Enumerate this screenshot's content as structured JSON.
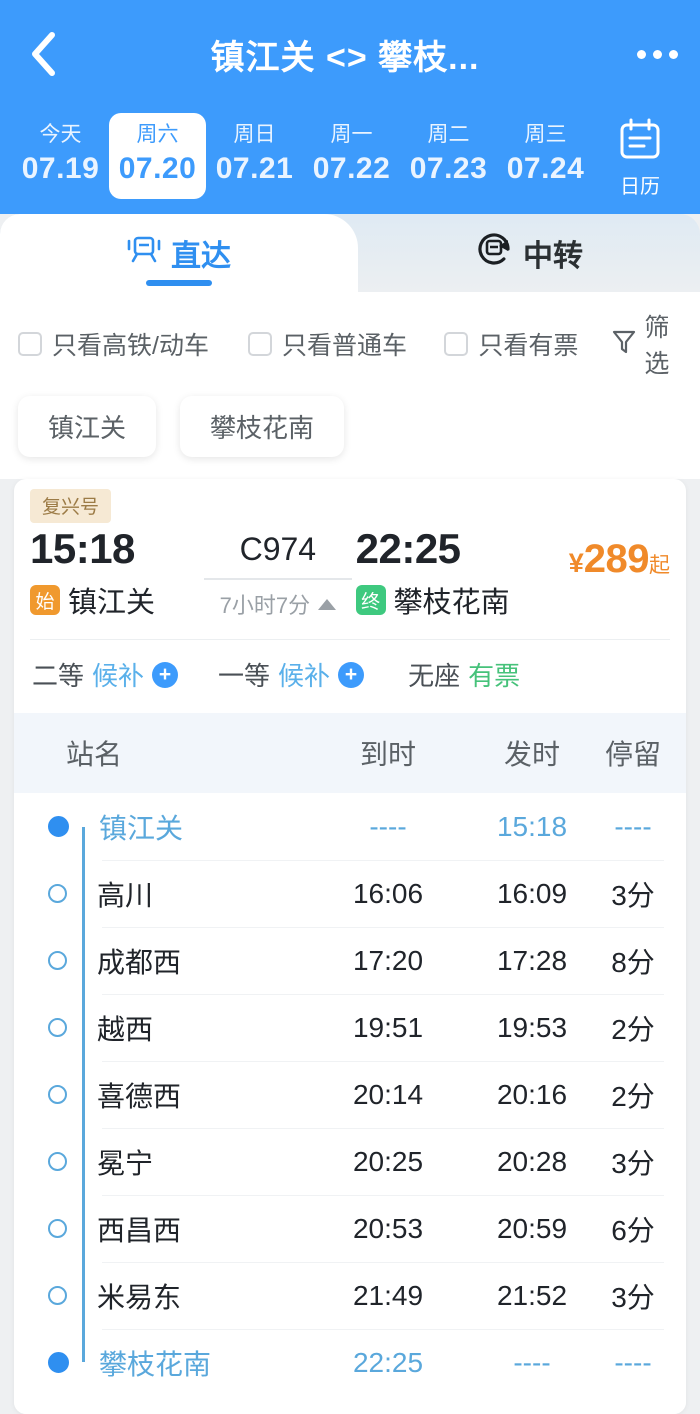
{
  "header": {
    "title": "镇江关 <> 攀枝...",
    "back_icon": "chevron-left-icon",
    "more_icon": "more-horizontal-icon",
    "calendar": {
      "icon": "calendar-icon",
      "label": "日历"
    },
    "days": [
      {
        "dow": "今天",
        "date": "07.19",
        "selected": false
      },
      {
        "dow": "周六",
        "date": "07.20",
        "selected": true
      },
      {
        "dow": "周日",
        "date": "07.21",
        "selected": false
      },
      {
        "dow": "周一",
        "date": "07.22",
        "selected": false
      },
      {
        "dow": "周二",
        "date": "07.23",
        "selected": false
      },
      {
        "dow": "周三",
        "date": "07.24",
        "selected": false
      }
    ]
  },
  "tabs": [
    {
      "label": "直达",
      "icon": "train-icon",
      "active": true
    },
    {
      "label": "中转",
      "icon": "transfer-train-icon",
      "active": false
    }
  ],
  "filters": {
    "checkboxes": [
      {
        "label": "只看高铁/动车",
        "checked": false
      },
      {
        "label": "只看普通车",
        "checked": false
      },
      {
        "label": "只看有票",
        "checked": false
      }
    ],
    "filter_button": {
      "label": "筛选",
      "icon": "funnel-icon"
    }
  },
  "station_chips": [
    "镇江关",
    "攀枝花南"
  ],
  "train_card": {
    "type_badge": "复兴号",
    "depart_time": "15:18",
    "depart_station": "镇江关",
    "depart_badge": "始",
    "train_number": "C974",
    "duration": "7小时7分",
    "arrive_time": "22:25",
    "arrive_station": "攀枝花南",
    "arrive_badge": "终",
    "price_symbol": "¥",
    "price": "289",
    "price_suffix": "起",
    "seats": [
      {
        "label": "二等",
        "status": "候补",
        "type": "wait",
        "plus": "+"
      },
      {
        "label": "一等",
        "status": "候补",
        "type": "wait",
        "plus": "+"
      },
      {
        "label": "无座",
        "status": "有票",
        "type": "has"
      }
    ]
  },
  "stops_table": {
    "columns": [
      "站名",
      "到时",
      "发时",
      "停留"
    ],
    "rows": [
      {
        "name": "镇江关",
        "arrive": "----",
        "depart": "15:18",
        "stay": "----",
        "endpoint": true
      },
      {
        "name": "高川",
        "arrive": "16:06",
        "depart": "16:09",
        "stay": "3分",
        "endpoint": false
      },
      {
        "name": "成都西",
        "arrive": "17:20",
        "depart": "17:28",
        "stay": "8分",
        "endpoint": false
      },
      {
        "name": "越西",
        "arrive": "19:51",
        "depart": "19:53",
        "stay": "2分",
        "endpoint": false
      },
      {
        "name": "喜德西",
        "arrive": "20:14",
        "depart": "20:16",
        "stay": "2分",
        "endpoint": false
      },
      {
        "name": "冕宁",
        "arrive": "20:25",
        "depart": "20:28",
        "stay": "3分",
        "endpoint": false
      },
      {
        "name": "西昌西",
        "arrive": "20:53",
        "depart": "20:59",
        "stay": "6分",
        "endpoint": false
      },
      {
        "name": "米易东",
        "arrive": "21:49",
        "depart": "21:52",
        "stay": "3分",
        "endpoint": false
      },
      {
        "name": "攀枝花南",
        "arrive": "22:25",
        "depart": "----",
        "stay": "----",
        "endpoint": true
      }
    ]
  },
  "colors": {
    "brand_blue": "#3d9bfc",
    "accent_orange": "#f08a2a",
    "green": "#46c27a",
    "rail_blue": "#5aa8dc"
  }
}
